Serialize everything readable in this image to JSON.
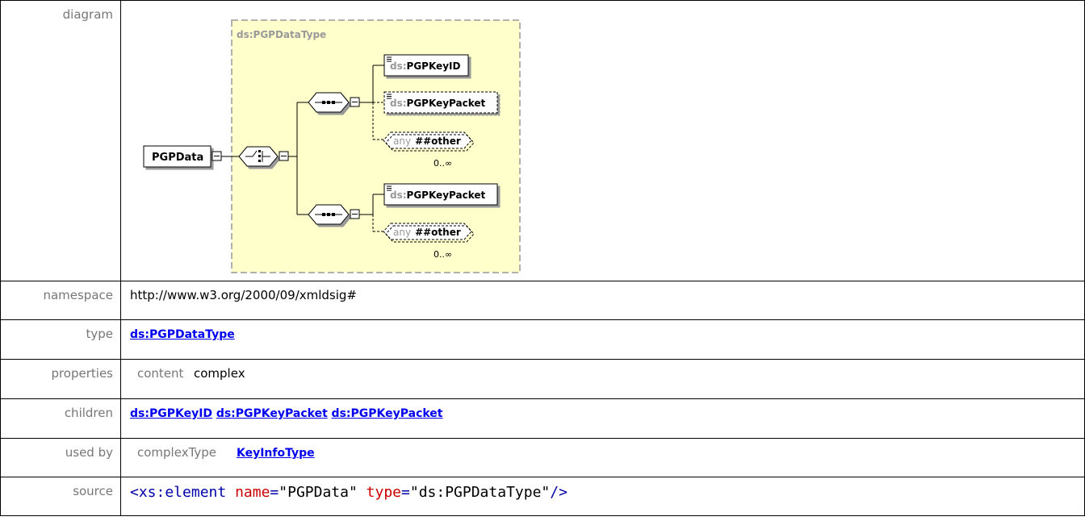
{
  "labels": {
    "diagram": "diagram",
    "namespace": "namespace",
    "type": "type",
    "properties": "properties",
    "children": "children",
    "used_by": "used by",
    "source": "source"
  },
  "diagram": {
    "group_title": "ds:PGPDataType",
    "root_element": "PGPData",
    "seq1": {
      "key_id": {
        "prefix": "ds:",
        "name": "PGPKeyID"
      },
      "key_packet": {
        "prefix": "ds:",
        "name": "PGPKeyPacket"
      },
      "any": {
        "kw": "any",
        "ns": "##other",
        "card": "0..∞"
      }
    },
    "seq2": {
      "key_packet": {
        "prefix": "ds:",
        "name": "PGPKeyPacket"
      },
      "any": {
        "kw": "any",
        "ns": "##other",
        "card": "0..∞"
      }
    },
    "colors": {
      "group_fill": "#ffffcc",
      "group_border": "#999999"
    }
  },
  "namespace": "http://www.w3.org/2000/09/xmldsig#",
  "type_link": "ds:PGPDataType",
  "properties": {
    "key": "content",
    "value": "complex"
  },
  "children": [
    "ds:PGPKeyID",
    "ds:PGPKeyPacket",
    "ds:PGPKeyPacket"
  ],
  "used_by": {
    "kind": "complexType",
    "link": "KeyInfoType"
  },
  "source": {
    "open": "<xs:element",
    "attr1": "name",
    "eq1": "=",
    "val1": "\"PGPData\"",
    "attr2": "type",
    "eq2": "=",
    "val2": "\"ds:PGPDataType\"",
    "close": "/>"
  }
}
